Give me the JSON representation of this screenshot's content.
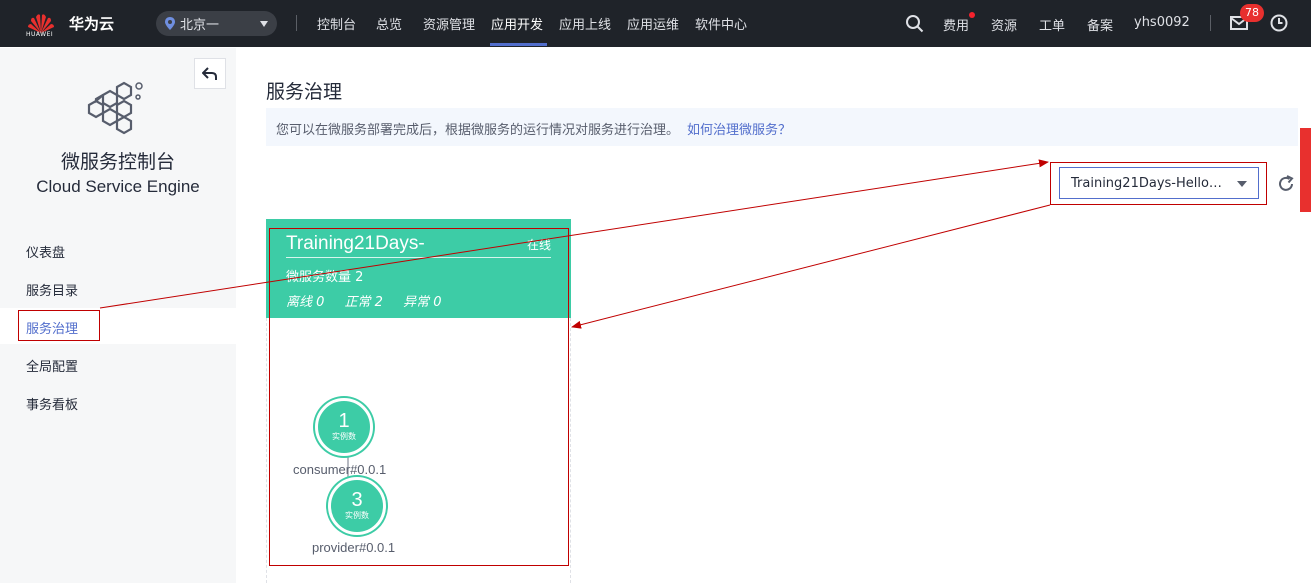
{
  "topbar": {
    "logo_text": "HUAWEI",
    "brand": "华为云",
    "region": "北京一",
    "nav": [
      "控制台",
      "总览",
      "资源管理",
      "应用开发",
      "应用上线",
      "应用运维",
      "软件中心"
    ],
    "active_nav": "应用开发",
    "tools": {
      "fee": "费用",
      "resource": "资源",
      "ticket": "工单",
      "record": "备案",
      "user": "yhs0092"
    },
    "mail_badge": "78",
    "colors": {
      "bg": "#1f2329",
      "accent": "#526ecc",
      "badge": "#e8302e"
    }
  },
  "sidebar": {
    "title_cn": "微服务控制台",
    "title_en": "Cloud Service Engine",
    "items": [
      {
        "label": "仪表盘"
      },
      {
        "label": "服务目录"
      },
      {
        "label": "服务治理"
      },
      {
        "label": "全局配置"
      },
      {
        "label": "事务看板"
      }
    ],
    "active": "服务治理"
  },
  "main": {
    "title": "服务治理",
    "info_text": "您可以在微服务部署完成后，根据微服务的运行情况对服务进行治理。",
    "info_link": "如何治理微服务？",
    "app_select": "Training21Days-Hello…",
    "card": {
      "name": "Training21Days-",
      "status": "在线",
      "service_count": "微服务数量 2",
      "offline": "离线 0",
      "normal": "正常 2",
      "abnormal": "异常 0",
      "color": "#3dcca6"
    },
    "nodes": [
      {
        "count": "1",
        "label": "实例数",
        "name": "consumer#0.0.1"
      },
      {
        "count": "3",
        "label": "实例数",
        "name": "provider#0.0.1"
      }
    ]
  },
  "annotation_color": "#c00000"
}
